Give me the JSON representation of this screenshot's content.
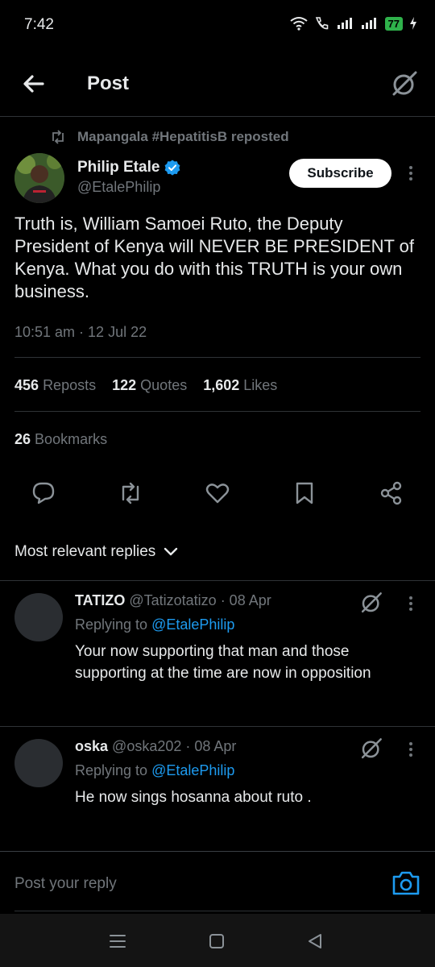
{
  "status_bar": {
    "time": "7:42",
    "battery": "77"
  },
  "header": {
    "title": "Post"
  },
  "repost_note": "Mapangala #HepatitisB reposted",
  "post": {
    "author_name": "Philip Etale",
    "author_handle": "@EtalePhilip",
    "subscribe_label": "Subscribe",
    "text": "Truth is, William Samoei Ruto, the Deputy President of Kenya will NEVER BE PRESIDENT of Kenya. What you do with this TRUTH is your own business.",
    "timestamp": "10:51 am · 12 Jul 22",
    "reposts_count": "456",
    "reposts_label": "Reposts",
    "quotes_count": "122",
    "quotes_label": "Quotes",
    "likes_count": "1,602",
    "likes_label": "Likes",
    "bookmarks_count": "26",
    "bookmarks_label": "Bookmarks"
  },
  "replies_filter": "Most relevant replies",
  "replies": [
    {
      "name": "TATIZO",
      "handle": "@Tatizotatizo",
      "date": "· 08 Apr",
      "replying_prefix": "Replying to",
      "replying_to": "@EtalePhilip",
      "text": "Your now supporting that man and those supporting at the time are now in opposition"
    },
    {
      "name": "oska",
      "handle": "@oska202",
      "date": "· 08 Apr",
      "replying_prefix": "Replying to",
      "replying_to": "@EtalePhilip",
      "text": "He now sings hosanna about ruto ."
    }
  ],
  "composer": {
    "placeholder": "Post your reply"
  },
  "colors": {
    "accent": "#1d9bf0",
    "background": "#000000",
    "muted": "#71767b"
  }
}
